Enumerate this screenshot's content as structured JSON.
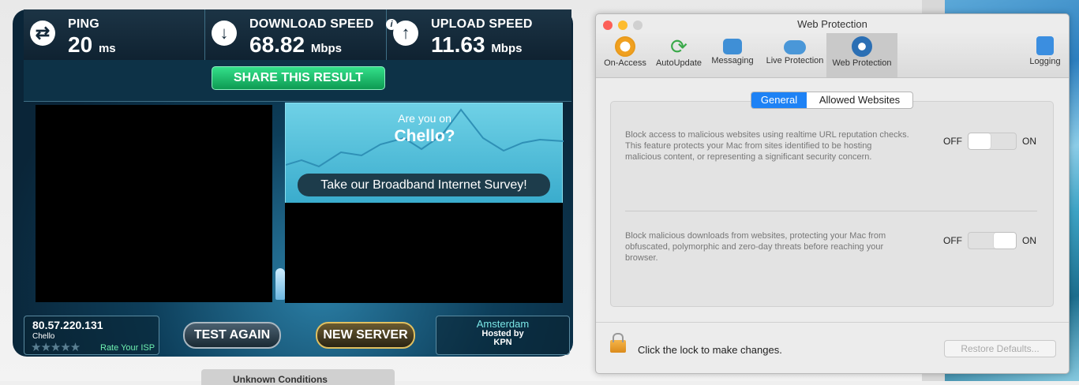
{
  "speedtest": {
    "ping": {
      "label": "PING",
      "value": "20",
      "unit": "ms"
    },
    "download": {
      "label": "DOWNLOAD SPEED",
      "value": "68.82",
      "unit": "Mbps"
    },
    "upload": {
      "label": "UPLOAD SPEED",
      "value": "11.63",
      "unit": "Mbps"
    },
    "share_label": "SHARE THIS RESULT",
    "survey": {
      "question": "Are you on",
      "isp": "Chello?",
      "button": "Take our Broadband Internet Survey!"
    },
    "ip": "80.57.220.131",
    "isp_name": "Chello",
    "stars": "★★★★★",
    "rate_label": "Rate Your ISP",
    "test_again": "TEST AGAIN",
    "new_server": "NEW SERVER",
    "server": {
      "city": "Amsterdam",
      "hosted_line1": "Hosted by",
      "hosted_line2": "KPN"
    }
  },
  "window": {
    "title": "Web Protection",
    "toolbar": [
      {
        "label": "On-Access",
        "icon": "on-access-icon"
      },
      {
        "label": "AutoUpdate",
        "icon": "autoupdate-icon"
      },
      {
        "label": "Messaging",
        "icon": "messaging-icon"
      },
      {
        "label": "Live Protection",
        "icon": "live-protection-icon"
      },
      {
        "label": "Web Protection",
        "icon": "web-protection-icon"
      },
      {
        "label": "Logging",
        "icon": "logging-icon"
      }
    ],
    "tabs": {
      "general": "General",
      "allowed": "Allowed Websites"
    },
    "settings": [
      {
        "description": "Block access to malicious websites using realtime URL reputation checks. This feature protects your Mac from sites identified to be hosting malicious content, or representing a significant security concern.",
        "off": "OFF",
        "on": "ON",
        "state": 0
      },
      {
        "description": "Block malicious downloads from websites, protecting your Mac from obfuscated, polymorphic and zero-day threats before reaching your browser.",
        "off": "OFF",
        "on": "ON",
        "state": 1
      }
    ],
    "footer": {
      "lock_text": "Click the lock to make changes.",
      "restore": "Restore Defaults..."
    }
  },
  "bottom_tab": "Unknown Conditions"
}
